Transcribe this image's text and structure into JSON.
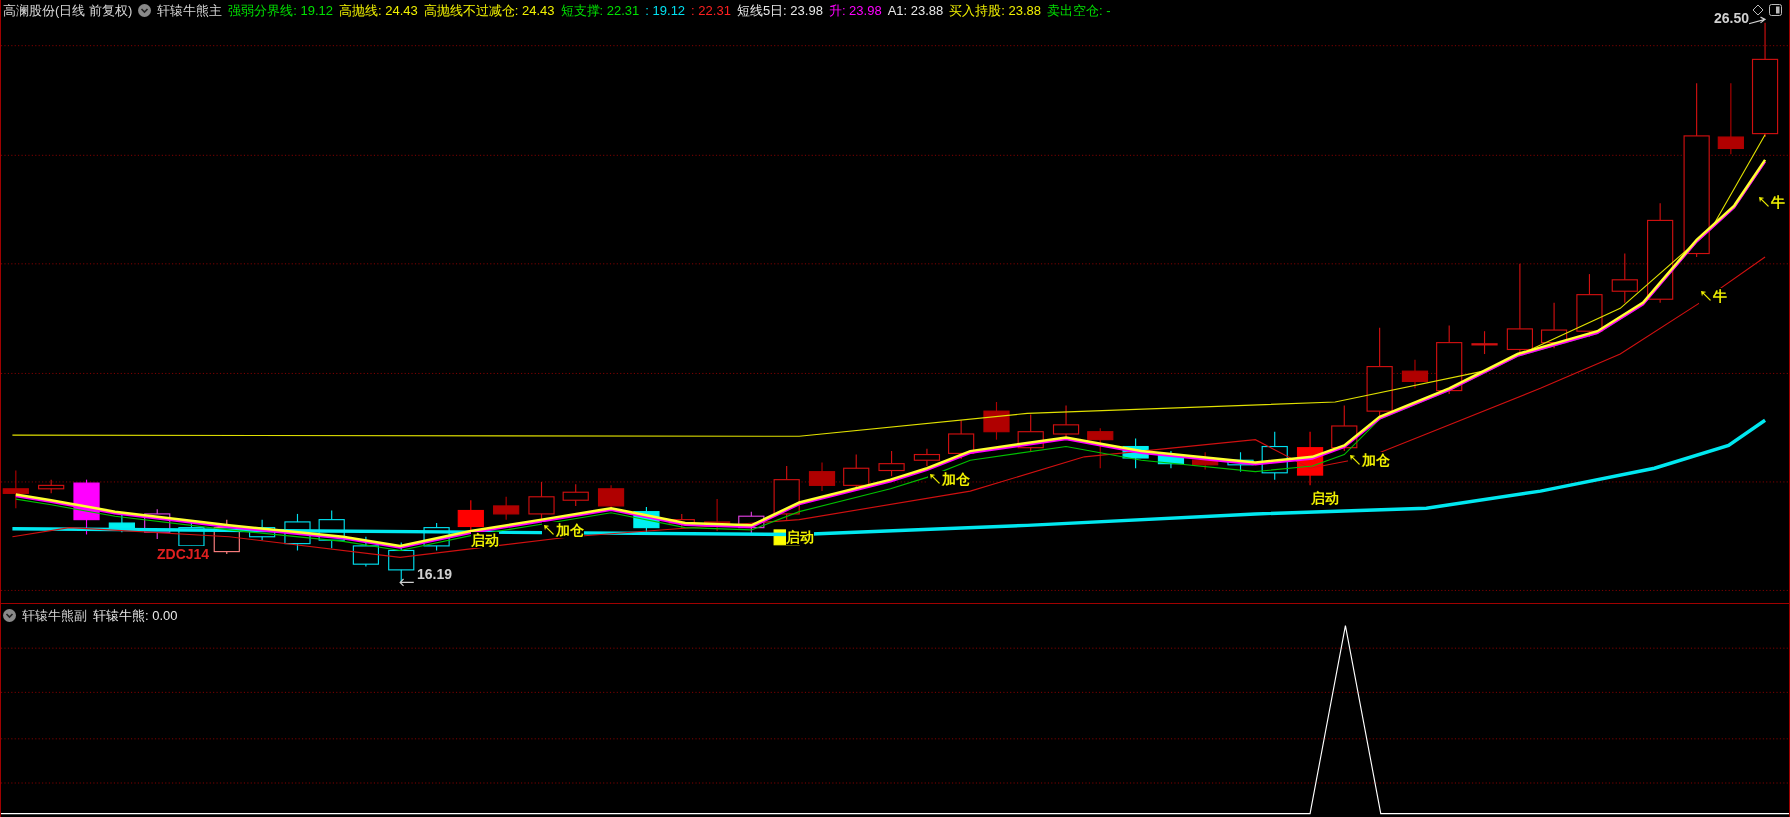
{
  "main_panel": {
    "title": "高澜股份(日线 前复权)",
    "indicator": "轩辕牛熊主",
    "legend": [
      {
        "text": "强弱分界线: 19.12",
        "color": "#00e000"
      },
      {
        "text": "高抛线: 24.43",
        "color": "#f0f000"
      },
      {
        "text": "高抛线不过减仓: 24.43",
        "color": "#f0f000"
      },
      {
        "text": "短支撑: 22.31",
        "color": "#00e000"
      },
      {
        "text": ": 19.12",
        "color": "#00e0f0"
      },
      {
        "text": ": 22.31",
        "color": "#ff2020"
      },
      {
        "text": "短线5日: 23.98",
        "color": "#e8e8e8"
      },
      {
        "text": "升: 23.98",
        "color": "#ff00ff"
      },
      {
        "text": "A1: 23.88",
        "color": "#e8e8e8"
      },
      {
        "text": "买入持股: 23.88",
        "color": "#f0f000"
      },
      {
        "text": "卖出空仓: -",
        "color": "#00e000"
      }
    ],
    "annotations": [
      {
        "text": "26.50",
        "color": "#d0d0d0"
      },
      {
        "text": "16.19",
        "color": "#d0d0d0"
      },
      {
        "text": "ZDCJ14",
        "color": "#e02020"
      },
      {
        "text": "启动",
        "color": "#f0f000"
      },
      {
        "text": "启动",
        "color": "#f0f000"
      },
      {
        "text": "启动",
        "color": "#f0f000"
      },
      {
        "text": "↖加仓",
        "color": "#f0f000"
      },
      {
        "text": "↖加仓",
        "color": "#f0f000"
      },
      {
        "text": "↖加仓",
        "color": "#f0f000"
      },
      {
        "text": "↖牛",
        "color": "#f0f000"
      },
      {
        "text": "↖牛",
        "color": "#f0f000"
      }
    ]
  },
  "sub_panel": {
    "indicator": "轩辕牛熊副",
    "legend": [
      {
        "text": "轩辕牛熊: 0.00",
        "color": "#e8e8e8"
      }
    ]
  }
}
